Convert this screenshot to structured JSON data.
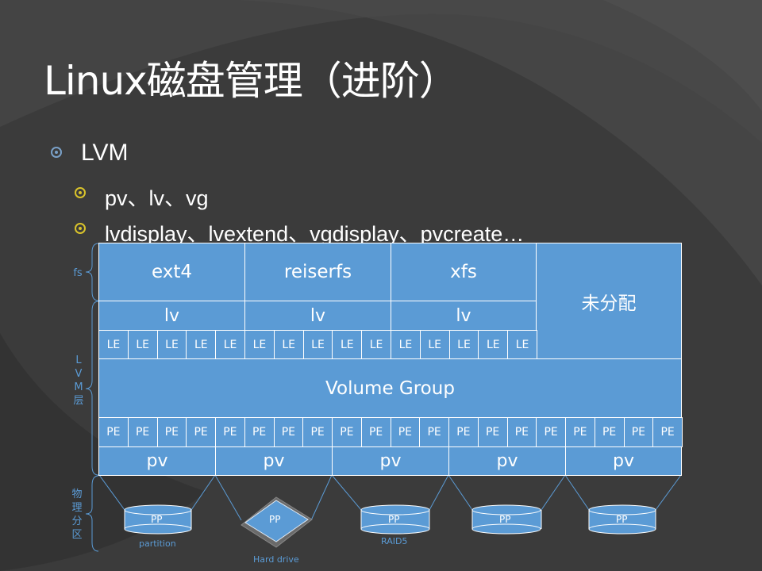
{
  "slide": {
    "title": "Linux磁盘管理（进阶）",
    "bullets": [
      "LVM",
      "pv、lv、vg",
      "lvdisplay、lvextend、vgdisplay、pvcreate…"
    ]
  },
  "diagram": {
    "fs_label": "fs",
    "lvm_label": [
      "L",
      "V",
      "M",
      "层"
    ],
    "physical_label": [
      "物",
      "理",
      "分",
      "区"
    ],
    "filesystems": [
      "ext4",
      "reiserfs",
      "xfs"
    ],
    "unallocated": "未分配",
    "lv": [
      "lv",
      "lv",
      "lv"
    ],
    "le_label": "LE",
    "volume_group": "Volume Group",
    "pe_label": "PE",
    "pv": [
      "pv",
      "pv",
      "pv",
      "pv",
      "pv"
    ],
    "pp_label": "PP",
    "device_labels": {
      "partition": "partition",
      "hard_drive": "Hard drive",
      "raid": "RAID5"
    },
    "colors": {
      "box": "#5b9bd5",
      "border": "#ffffff",
      "label": "#5b9bd5"
    }
  }
}
